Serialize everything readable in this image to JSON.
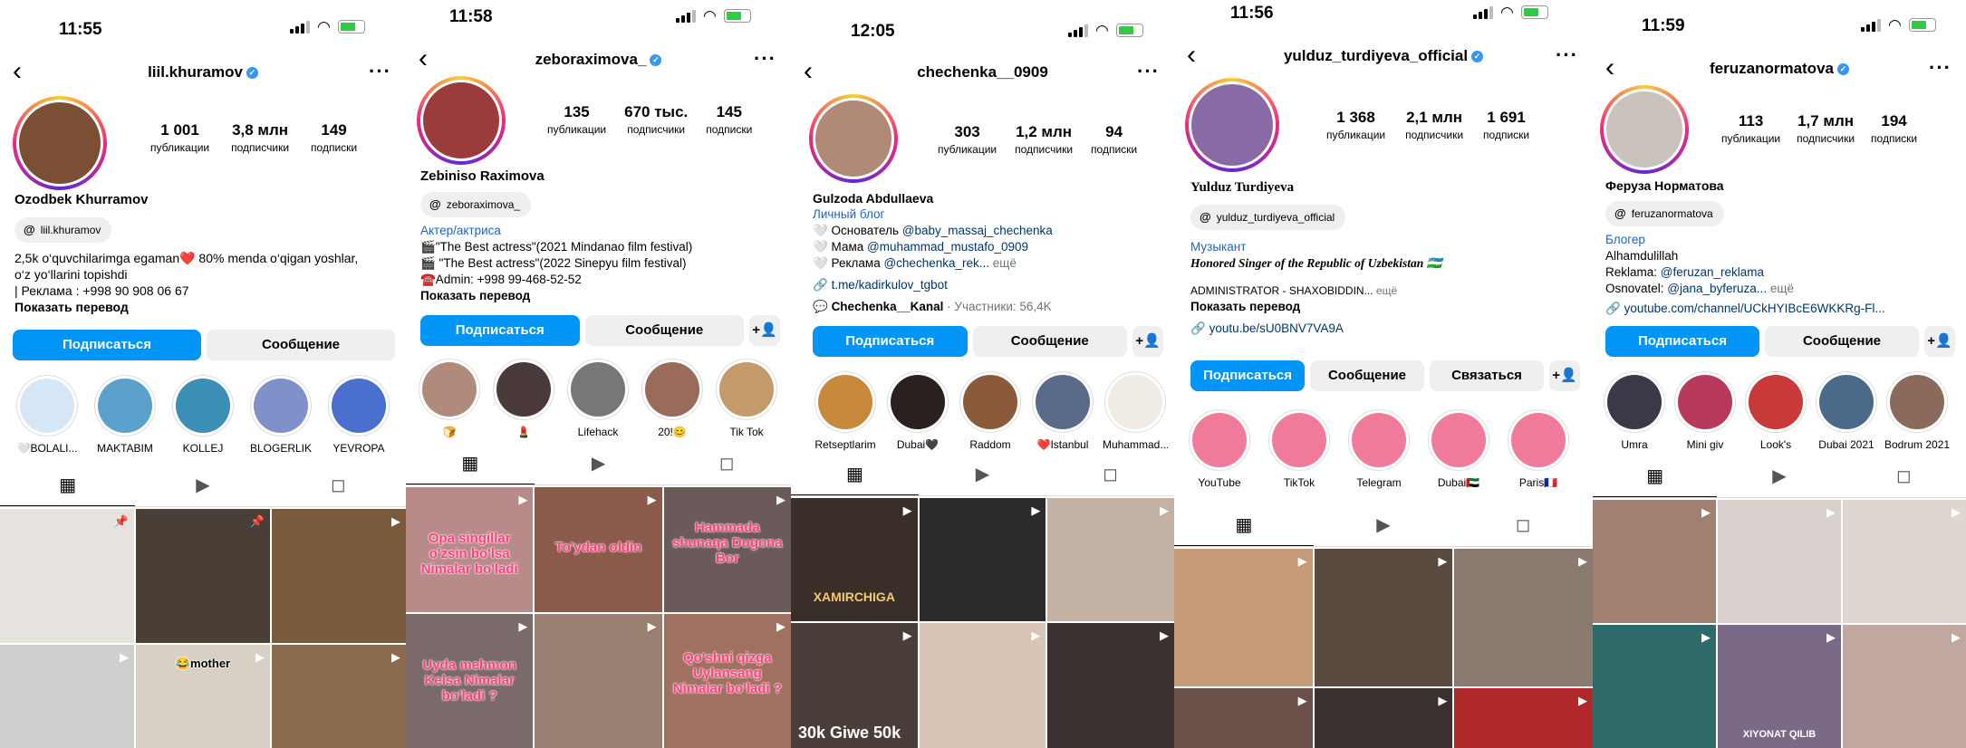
{
  "panels": [
    {
      "time": "11:55",
      "username": "liil.khuramov",
      "stats": [
        {
          "n": "1 001",
          "l": "публикации"
        },
        {
          "n": "3,8 млн",
          "l": "подписчики"
        },
        {
          "n": "149",
          "l": "подписки"
        }
      ],
      "full_name": "Ozodbek Khurramov",
      "threads": "liil.khuramov",
      "bio": [
        "2,5k o‘quvchilarimga egaman❤️ 80% menda o‘qigan yoshlar,",
        "o‘z yo‘llarini topishdi",
        "| Реклама : +998 90 908 06 67"
      ],
      "translate": "Показать перевод",
      "buttons": [
        "Подписаться",
        "Сообщение"
      ],
      "highlights": [
        "🤍BOLALI...",
        "MAKTABIM",
        "KOLLEJ",
        "BLOGERLIK",
        "YEVROPA"
      ],
      "posts": [
        {
          "color": "#e6e2dd",
          "cap": ""
        },
        {
          "color": "#4a3f36",
          "cap": ""
        },
        {
          "color": "#7a5a3c",
          "cap": ""
        },
        {
          "color": "#cfcfcf",
          "cap": ""
        },
        {
          "color": "#d8cfc5",
          "cap": "😂mother"
        },
        {
          "color": "#8b6b4c",
          "cap": ""
        }
      ]
    },
    {
      "time": "11:58",
      "username": "zeboraximova_",
      "stats": [
        {
          "n": "135",
          "l": "публикации"
        },
        {
          "n": "670 тыс.",
          "l": "подписчики"
        },
        {
          "n": "145",
          "l": "подписки"
        }
      ],
      "full_name": "Zebiniso Raximova",
      "threads": "zeboraximova_",
      "category": "Актер/актриса",
      "bio": [
        "🎬\"The Best actress\"(2021 Mindanao film festival)",
        "🎬 \"The Best actress\"(2022 Sinepyu film festival)",
        "☎️Admin: +998 99-468-52-52"
      ],
      "translate": "Показать перевод",
      "buttons": [
        "Подписаться",
        "Сообщение"
      ],
      "highlights": [
        "🍞",
        "💄",
        "Lifehack",
        "20!😊",
        "Tik Tok"
      ],
      "posts": [
        {
          "color": "#b88a8a",
          "cap": "Opa singillar o'zsin bo'lsa Nimalar bo'ladi"
        },
        {
          "color": "#8a5a4a",
          "cap": "To'ydan oldin"
        },
        {
          "color": "#6a5a5a",
          "cap": "Hammada shunaqa Dugona Bor"
        },
        {
          "color": "#7a6a6a",
          "cap": "Uyda mehmon Kelsa Nimalar bo'ladi ?"
        },
        {
          "color": "#9a8070",
          "cap": ""
        },
        {
          "color": "#a07060",
          "cap": "Qo'shni qizga Uylansang Nimalar bo'ladi ?"
        }
      ]
    },
    {
      "time": "12:05",
      "username": "chechenka__0909",
      "stats": [
        {
          "n": "303",
          "l": "публикации"
        },
        {
          "n": "1,2 млн",
          "l": "подписчики"
        },
        {
          "n": "94",
          "l": "подписки"
        }
      ],
      "full_name": "Gulzoda Abdullaeva",
      "category": "Личный блог",
      "bio_lines": [
        {
          "pre": "🤍 Основатель ",
          "tag": "@baby_massaj_chechenka"
        },
        {
          "pre": "🤍 Мама ",
          "tag": "@muhammad_mustafo_0909"
        },
        {
          "pre": "🤍 Реклама ",
          "tag": "@chechenka_rek...",
          "more": " ещё"
        }
      ],
      "link": "t.me/kadirkulov_tgbot",
      "channel": "Chechenka__Kanal",
      "channel_members": " · Участники: 56,4K",
      "buttons": [
        "Подписаться",
        "Сообщение"
      ],
      "highlights": [
        "Retseptlarim",
        "Dubai🖤",
        "Raddom",
        "❤️Istanbul",
        "Muhammad..."
      ],
      "posts": [
        {
          "color": "#3a2f28",
          "cap": "XAMIRCHIGA"
        },
        {
          "color": "#2a2a2a",
          "cap": ""
        },
        {
          "color": "#c4b2a4",
          "cap": ""
        },
        {
          "color": "#4a3e38",
          "cap": "30k Giwe 50k"
        },
        {
          "color": "#d9c4b6",
          "cap": ""
        },
        {
          "color": "#3a3230",
          "cap": ""
        }
      ]
    },
    {
      "time": "11:56",
      "username": "yulduz_turdiyeva_official",
      "stats": [
        {
          "n": "1 368",
          "l": "публикации"
        },
        {
          "n": "2,1 млн",
          "l": "подписчики"
        },
        {
          "n": "1 691",
          "l": "подписки"
        }
      ],
      "full_name": "Yulduz Turdiyeva",
      "threads": "yulduz_turdiyeva_official",
      "category": "Музыкант",
      "bio_italic": "Honored Singer of the Republic of Uzbekistan 🇺🇿",
      "admin": "ADMINISTRATOR - SHAXOBIDDIN...",
      "admin_more": " ещё",
      "translate": "Показать перевод",
      "link": "youtu.be/sU0BNV7VA9A",
      "buttons": [
        "Подписаться",
        "Сообщение",
        "Связаться"
      ],
      "highlights": [
        "YouTube",
        "TikTok",
        "Telegram",
        "Dubai🇦🇪",
        "Paris🇫🇷"
      ],
      "posts": [
        {
          "color": "#c79a7a",
          "cap": ""
        },
        {
          "color": "#5a4a40",
          "cap": ""
        },
        {
          "color": "#8a7a70",
          "cap": ""
        },
        {
          "color": "#6a5048",
          "cap": ""
        },
        {
          "color": "#3a3030",
          "cap": ""
        },
        {
          "color": "#b02828",
          "cap": ""
        }
      ]
    },
    {
      "time": "11:59",
      "username": "feruzanormatova",
      "stats": [
        {
          "n": "113",
          "l": "публикации"
        },
        {
          "n": "1,7 млн",
          "l": "подписчики"
        },
        {
          "n": "194",
          "l": "подписки"
        }
      ],
      "full_name": "Феруза Норматова",
      "threads": "feruzanormatova",
      "category": "Блогер",
      "bio_lines": [
        {
          "pre": "Alhamdulillah",
          "tag": ""
        },
        {
          "pre": "Reklama: ",
          "tag": "@feruzan_reklama"
        },
        {
          "pre": "Osnovatel: ",
          "tag": "@jana_byferuza...",
          "more": " ещё"
        }
      ],
      "link": "youtube.com/channel/UCkHYIBcE6WKKRg-Fl...",
      "buttons": [
        "Подписаться",
        "Сообщение"
      ],
      "highlights": [
        "Umra",
        "Mini giv",
        "Look's",
        "Dubai 2021",
        "Bodrum 2021"
      ],
      "posts": [
        {
          "color": "#a08070",
          "cap": ""
        },
        {
          "color": "#d8d0cc",
          "cap": ""
        },
        {
          "color": "#e0d6d0",
          "cap": ""
        },
        {
          "color": "#2e6a6a",
          "cap": ""
        },
        {
          "color": "#7a6a88",
          "cap": "XIYONAT QILIB"
        },
        {
          "color": "#c0a8a0",
          "cap": ""
        }
      ]
    }
  ]
}
